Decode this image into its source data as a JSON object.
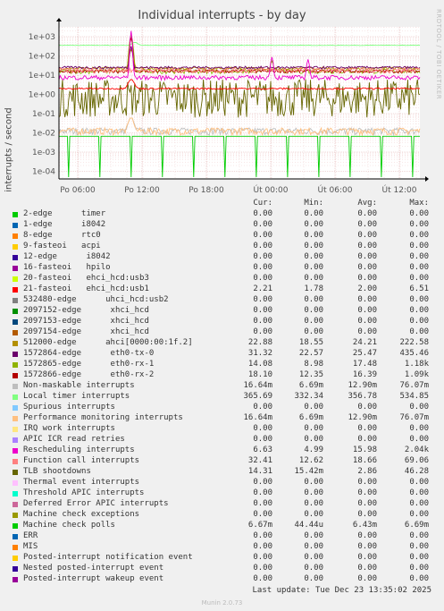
{
  "chart_data": {
    "type": "line",
    "title": "Individual interrupts - by day",
    "ylabel": "interrupts / second",
    "yscale": "log",
    "ylim": [
      5e-05,
      2000
    ],
    "yticks": [
      "1e+03",
      "1e+02",
      "1e+01",
      "1e+00",
      "1e-01",
      "1e-02",
      "1e-03",
      "1e-04"
    ],
    "xticks": [
      "Po 06:00",
      "Po 12:00",
      "Po 18:00",
      "Út 00:00",
      "Út 06:00",
      "Út 12:00"
    ],
    "grid": true,
    "columns": [
      "Cur:",
      "Min:",
      "Avg:",
      "Max:"
    ],
    "series": [
      {
        "name": "2-edge      timer",
        "color": "#00cc00",
        "cur": "0.00",
        "min": "0.00",
        "avg": "0.00",
        "max": "0.00"
      },
      {
        "name": "1-edge      i8042",
        "color": "#0066b3",
        "cur": "0.00",
        "min": "0.00",
        "avg": "0.00",
        "max": "0.00"
      },
      {
        "name": "8-edge      rtc0",
        "color": "#ff8000",
        "cur": "0.00",
        "min": "0.00",
        "avg": "0.00",
        "max": "0.00"
      },
      {
        "name": "9-fasteoi   acpi",
        "color": "#ffcc00",
        "cur": "0.00",
        "min": "0.00",
        "avg": "0.00",
        "max": "0.00"
      },
      {
        "name": "12-edge      i8042",
        "color": "#330099",
        "cur": "0.00",
        "min": "0.00",
        "avg": "0.00",
        "max": "0.00"
      },
      {
        "name": "16-fasteoi   hpilo",
        "color": "#990099",
        "cur": "0.00",
        "min": "0.00",
        "avg": "0.00",
        "max": "0.00"
      },
      {
        "name": "20-fasteoi   ehci_hcd:usb3",
        "color": "#ccff00",
        "cur": "0.00",
        "min": "0.00",
        "avg": "0.00",
        "max": "0.00"
      },
      {
        "name": "21-fasteoi   ehci_hcd:usb1",
        "color": "#ff0000",
        "cur": "2.21",
        "min": "1.78",
        "avg": "2.00",
        "max": "6.51"
      },
      {
        "name": "532480-edge      uhci_hcd:usb2",
        "color": "#808080",
        "cur": "0.00",
        "min": "0.00",
        "avg": "0.00",
        "max": "0.00"
      },
      {
        "name": "2097152-edge      xhci_hcd",
        "color": "#008f00",
        "cur": "0.00",
        "min": "0.00",
        "avg": "0.00",
        "max": "0.00"
      },
      {
        "name": "2097153-edge      xhci_hcd",
        "color": "#00487d",
        "cur": "0.00",
        "min": "0.00",
        "avg": "0.00",
        "max": "0.00"
      },
      {
        "name": "2097154-edge      xhci_hcd",
        "color": "#b35a00",
        "cur": "0.00",
        "min": "0.00",
        "avg": "0.00",
        "max": "0.00"
      },
      {
        "name": "512000-edge      ahci[0000:00:1f.2]",
        "color": "#b38f00",
        "cur": "22.88",
        "min": "18.55",
        "avg": "24.21",
        "max": "222.58"
      },
      {
        "name": "1572864-edge      eth0-tx-0",
        "color": "#6b006b",
        "cur": "31.32",
        "min": "22.57",
        "avg": "25.47",
        "max": "435.46"
      },
      {
        "name": "1572865-edge      eth0-rx-1",
        "color": "#8fb300",
        "cur": "14.08",
        "min": "8.98",
        "avg": "17.48",
        "max": "1.18k"
      },
      {
        "name": "1572866-edge      eth0-rx-2",
        "color": "#b30000",
        "cur": "18.10",
        "min": "12.35",
        "avg": "16.39",
        "max": "1.09k"
      },
      {
        "name": "Non-maskable interrupts",
        "color": "#bebebe",
        "cur": "16.64m",
        "min": "6.69m",
        "avg": "12.90m",
        "max": "76.07m"
      },
      {
        "name": "Local timer interrupts",
        "color": "#80ff80",
        "cur": "365.69",
        "min": "332.34",
        "avg": "356.78",
        "max": "534.85"
      },
      {
        "name": "Spurious interrupts",
        "color": "#80c9ff",
        "cur": "0.00",
        "min": "0.00",
        "avg": "0.00",
        "max": "0.00"
      },
      {
        "name": "Performance monitoring interrupts",
        "color": "#ffc080",
        "cur": "16.64m",
        "min": "6.69m",
        "avg": "12.90m",
        "max": "76.07m"
      },
      {
        "name": "IRQ work interrupts",
        "color": "#ffe680",
        "cur": "0.00",
        "min": "0.00",
        "avg": "0.00",
        "max": "0.00"
      },
      {
        "name": "APIC ICR read retries",
        "color": "#aa80ff",
        "cur": "0.00",
        "min": "0.00",
        "avg": "0.00",
        "max": "0.00"
      },
      {
        "name": "Rescheduling interrupts",
        "color": "#ee00cc",
        "cur": "6.63",
        "min": "4.99",
        "avg": "15.98",
        "max": "2.04k"
      },
      {
        "name": "Function call interrupts",
        "color": "#ff8080",
        "cur": "32.41",
        "min": "12.62",
        "avg": "18.66",
        "max": "69.06"
      },
      {
        "name": "TLB shootdowns",
        "color": "#666600",
        "cur": "14.31",
        "min": "15.42m",
        "avg": "2.86",
        "max": "46.28"
      },
      {
        "name": "Thermal event interrupts",
        "color": "#ffbfff",
        "cur": "0.00",
        "min": "0.00",
        "avg": "0.00",
        "max": "0.00"
      },
      {
        "name": "Threshold APIC interrupts",
        "color": "#00ffcc",
        "cur": "0.00",
        "min": "0.00",
        "avg": "0.00",
        "max": "0.00"
      },
      {
        "name": "Deferred Error APIC interrupts",
        "color": "#cc6699",
        "cur": "0.00",
        "min": "0.00",
        "avg": "0.00",
        "max": "0.00"
      },
      {
        "name": "Machine check exceptions",
        "color": "#999900",
        "cur": "0.00",
        "min": "0.00",
        "avg": "0.00",
        "max": "0.00"
      },
      {
        "name": "Machine check polls",
        "color": "#00cc00",
        "cur": "6.67m",
        "min": "44.44u",
        "avg": "6.43m",
        "max": "6.69m"
      },
      {
        "name": "ERR",
        "color": "#0066b3",
        "cur": "0.00",
        "min": "0.00",
        "avg": "0.00",
        "max": "0.00"
      },
      {
        "name": "MIS",
        "color": "#ff8000",
        "cur": "0.00",
        "min": "0.00",
        "avg": "0.00",
        "max": "0.00"
      },
      {
        "name": "Posted-interrupt notification event",
        "color": "#ffcc00",
        "cur": "0.00",
        "min": "0.00",
        "avg": "0.00",
        "max": "0.00"
      },
      {
        "name": "Nested posted-interrupt event",
        "color": "#330099",
        "cur": "0.00",
        "min": "0.00",
        "avg": "0.00",
        "max": "0.00"
      },
      {
        "name": "Posted-interrupt wakeup event",
        "color": "#990099",
        "cur": "0.00",
        "min": "0.00",
        "avg": "0.00",
        "max": "0.00"
      }
    ]
  },
  "vendor": "RRDTOOL / TOBI OETIKER",
  "footer": {
    "last_update": "Last update: Tue Dec 23 13:35:02 2025",
    "munin": "Munin 2.0.73"
  }
}
